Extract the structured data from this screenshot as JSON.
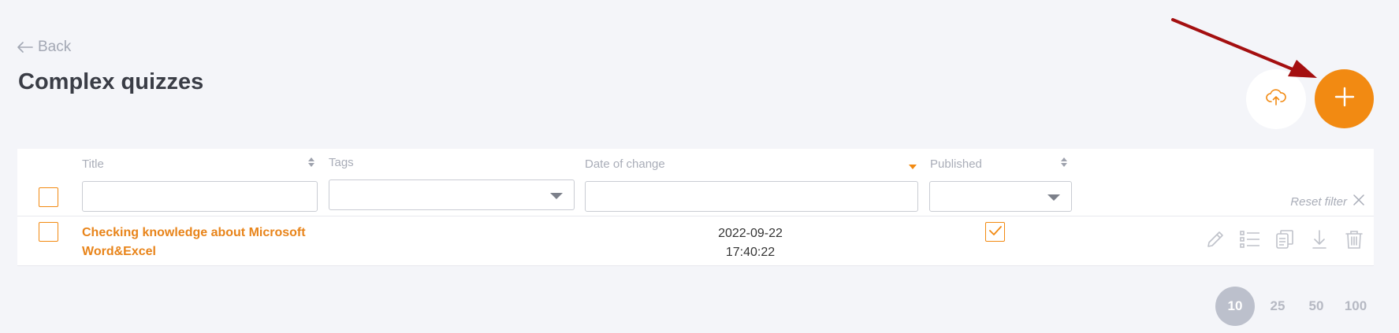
{
  "nav": {
    "back_label": "Back"
  },
  "page": {
    "title": "Complex quizzes"
  },
  "toolbar": {
    "upload_icon": "cloud-upload-icon",
    "add_icon": "plus-icon"
  },
  "table": {
    "columns": [
      {
        "label": "Title",
        "sort": "sortable"
      },
      {
        "label": "Tags",
        "sort": "none"
      },
      {
        "label": "Date of change",
        "sort": "descending"
      },
      {
        "label": "Published",
        "sort": "sortable"
      }
    ],
    "filters": {
      "title_value": "",
      "tags_value": "",
      "date_value": "",
      "published_value": ""
    },
    "reset_filter_label": "Reset filter",
    "rows": [
      {
        "title": "Checking knowledge about Microsoft Word&Excel",
        "tags": "",
        "date": "2022-09-22",
        "time": "17:40:22",
        "published": true,
        "actions": [
          "edit-icon",
          "list-icon",
          "copy-icon",
          "download-icon",
          "trash-icon"
        ]
      }
    ]
  },
  "pagination": {
    "options": [
      "10",
      "25",
      "50",
      "100"
    ],
    "selected": "10"
  },
  "colors": {
    "accent": "#f28a12",
    "title_link": "#e8841a",
    "annotation_arrow": "#a40f10",
    "page_background": "#f4f5f9"
  }
}
